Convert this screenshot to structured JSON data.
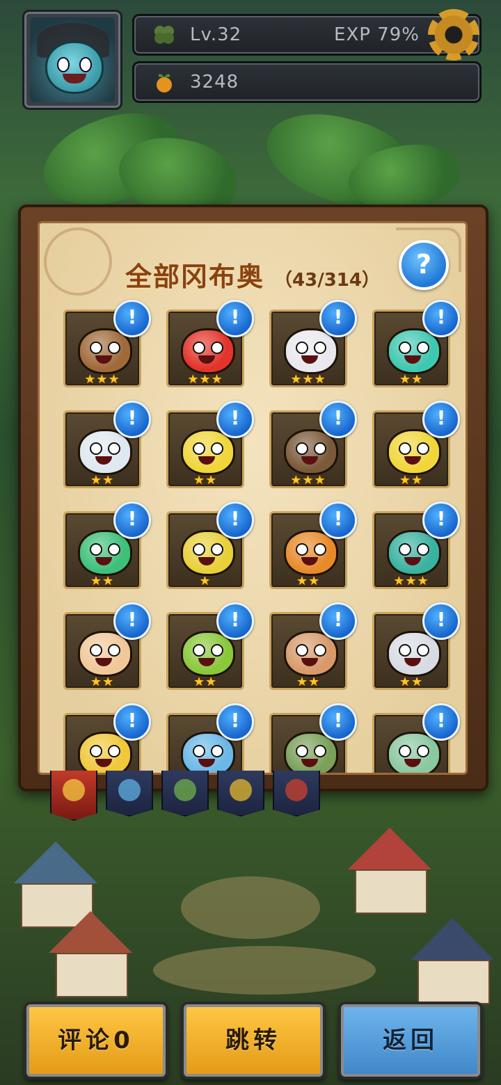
{
  "header": {
    "level": "Lv.32",
    "exp": "EXP 79%",
    "coins": "3248"
  },
  "panel": {
    "title": "全部冈布奥",
    "count": "（43/314）",
    "help_symbol": "?"
  },
  "collection": {
    "badge_symbol": "!",
    "items": [
      {
        "stars": "★★★",
        "color": "#a06a3a"
      },
      {
        "stars": "★★★",
        "color": "#e2342a"
      },
      {
        "stars": "★★★",
        "color": "#e8e8ee"
      },
      {
        "stars": "★★",
        "color": "#3fc8b0"
      },
      {
        "stars": "★★",
        "color": "#dfe8f0"
      },
      {
        "stars": "★★",
        "color": "#f0d63a"
      },
      {
        "stars": "★★★",
        "color": "#7a5a3a"
      },
      {
        "stars": "★★",
        "color": "#f0d63a"
      },
      {
        "stars": "★★",
        "color": "#3ec07a"
      },
      {
        "stars": "★",
        "color": "#e8d03a"
      },
      {
        "stars": "★★",
        "color": "#e88a2a"
      },
      {
        "stars": "★★★",
        "color": "#3ab2a0"
      },
      {
        "stars": "★★",
        "color": "#f0c89a"
      },
      {
        "stars": "★★",
        "color": "#8ac83a"
      },
      {
        "stars": "★★",
        "color": "#d89a6a"
      },
      {
        "stars": "★★",
        "color": "#d8dce2"
      },
      {
        "stars": "",
        "color": "#f0c83a"
      },
      {
        "stars": "",
        "color": "#6ab8e8"
      },
      {
        "stars": "",
        "color": "#7aa05a"
      },
      {
        "stars": "",
        "color": "#8ac8a0"
      }
    ]
  },
  "tabs": [
    {
      "name": "all",
      "color": "#f0c040"
    },
    {
      "name": "blue",
      "color": "#5aa8d8"
    },
    {
      "name": "green",
      "color": "#6aa84a"
    },
    {
      "name": "gold",
      "color": "#d8b030"
    },
    {
      "name": "red",
      "color": "#c04030"
    }
  ],
  "buttons": {
    "comment": "评论0",
    "jump": "跳转",
    "back": "返回"
  }
}
